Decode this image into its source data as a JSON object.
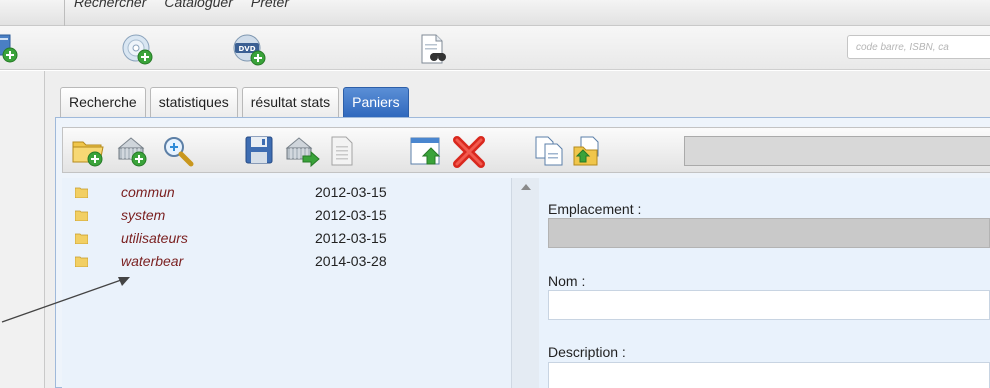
{
  "menu": {
    "items": [
      "Rechercher",
      "Cataloguer",
      "Prêter"
    ]
  },
  "toolbar": {
    "icons": [
      "add-record-icon",
      "add-cd-icon",
      "add-dvd-icon",
      "search-document-icon"
    ],
    "search_placeholder": "code barre, ISBN, ca"
  },
  "tabs": [
    {
      "label": "Recherche",
      "active": false
    },
    {
      "label": "statistiques",
      "active": false
    },
    {
      "label": "résultat stats",
      "active": false
    },
    {
      "label": "Paniers",
      "active": true
    }
  ],
  "inner_toolbar": {
    "icons": [
      "new-folder-icon",
      "new-basket-icon",
      "zoom-icon",
      "save-icon",
      "move-basket-icon",
      "document-icon",
      "window-export-icon",
      "delete-icon",
      "copy-icon",
      "paste-icon"
    ]
  },
  "baskets": [
    {
      "name": "commun",
      "date": "2012-03-15"
    },
    {
      "name": "system",
      "date": "2012-03-15"
    },
    {
      "name": "utilisateurs",
      "date": "2012-03-15"
    },
    {
      "name": "waterbear",
      "date": "2014-03-28"
    }
  ],
  "form": {
    "emplacement_label": "Emplacement :",
    "nom_label": "Nom :",
    "description_label": "Description :"
  },
  "colors": {
    "active_tab": "#3a74c6",
    "basket_name": "#7a1f1f",
    "panel_bg": "#eaf2fb"
  }
}
